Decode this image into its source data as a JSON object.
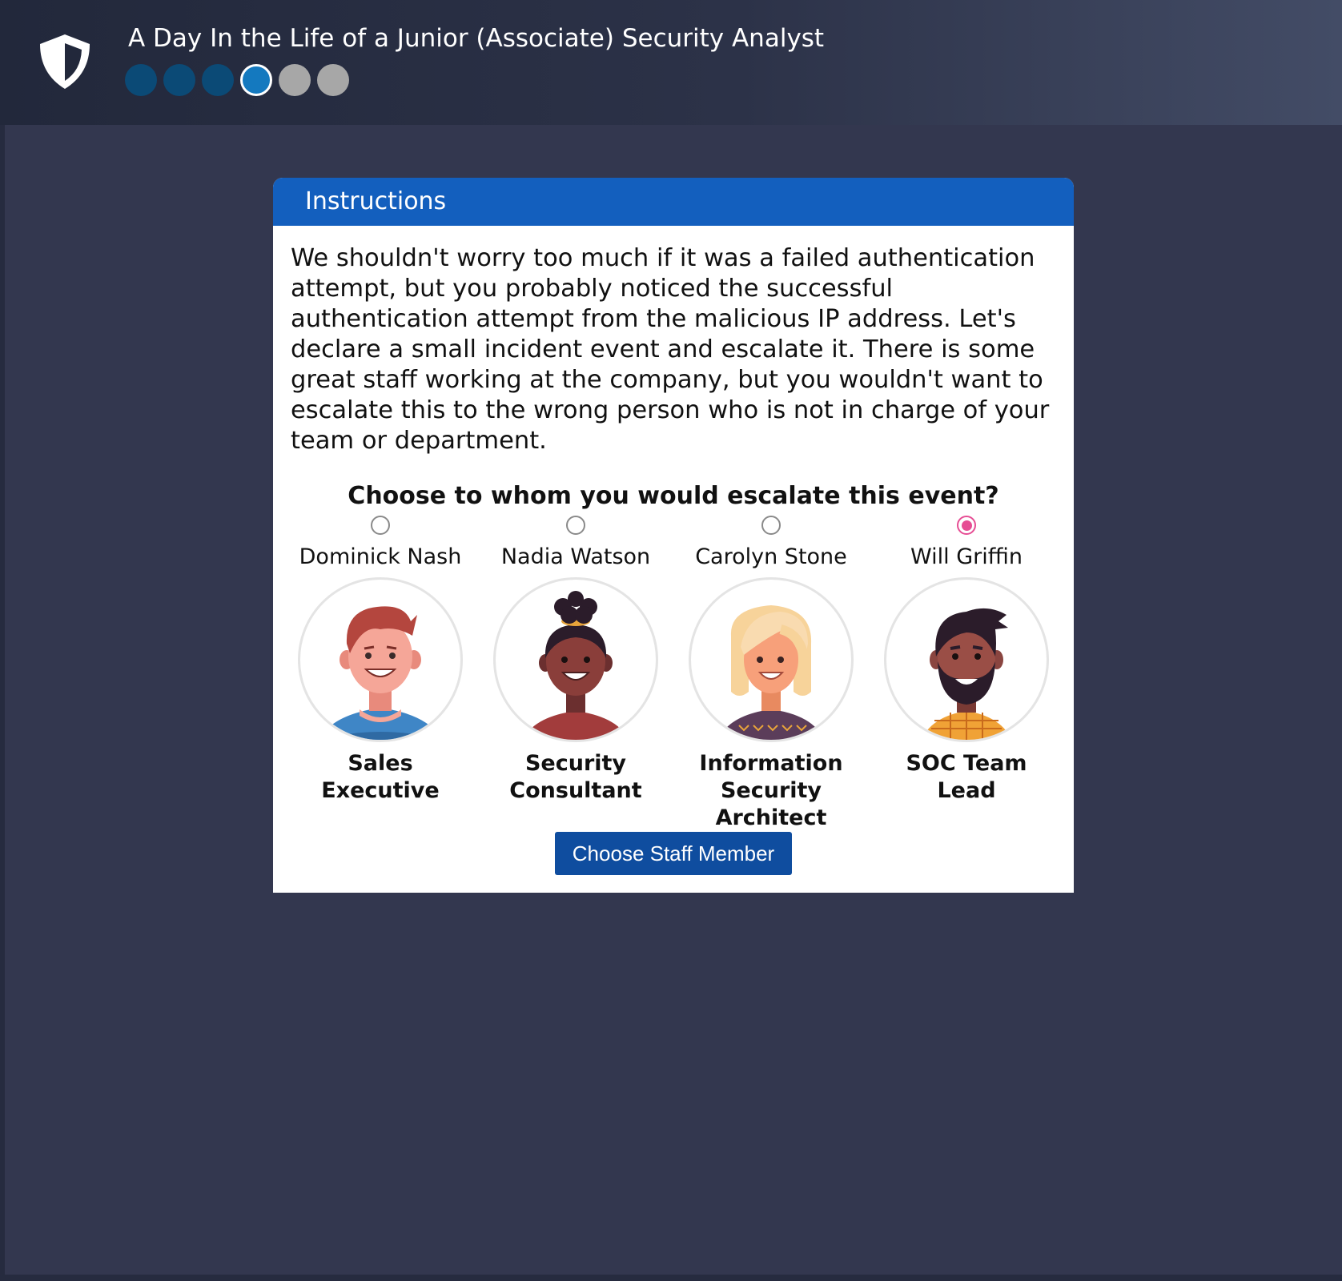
{
  "header": {
    "title": "A Day In the Life of a Junior (Associate) Security Analyst",
    "logo_icon": "shield-icon",
    "progress_steps": [
      "done",
      "done",
      "done",
      "current",
      "todo",
      "todo"
    ]
  },
  "card": {
    "header_label": "Instructions",
    "body_text": "We shouldn't worry too much if it was a failed authentication attempt, but you probably noticed the successful authentication attempt from the malicious IP address. Let's declare a small incident event and escalate it. There is some great staff working at the company, but you wouldn't want to escalate this to the wrong person who is not in charge of your team or department.",
    "question": "Choose to whom you would escalate this event?",
    "staff": [
      {
        "name": "Dominick Nash",
        "role": "Sales Executive",
        "selected": false
      },
      {
        "name": "Nadia Watson",
        "role": "Security Consultant",
        "selected": false
      },
      {
        "name": "Carolyn Stone",
        "role": "Information Security Architect",
        "selected": false
      },
      {
        "name": "Will Griffin",
        "role": "SOC Team Lead",
        "selected": true
      }
    ],
    "button_label": "Choose Staff Member"
  },
  "colors": {
    "background": "#33374f",
    "card_header": "#135fbe",
    "button": "#0f4d9f",
    "radio_selected": "#e64d94",
    "progress_done": "#0b4a76",
    "progress_current": "#1479bf",
    "progress_todo": "#a7a7a7"
  }
}
